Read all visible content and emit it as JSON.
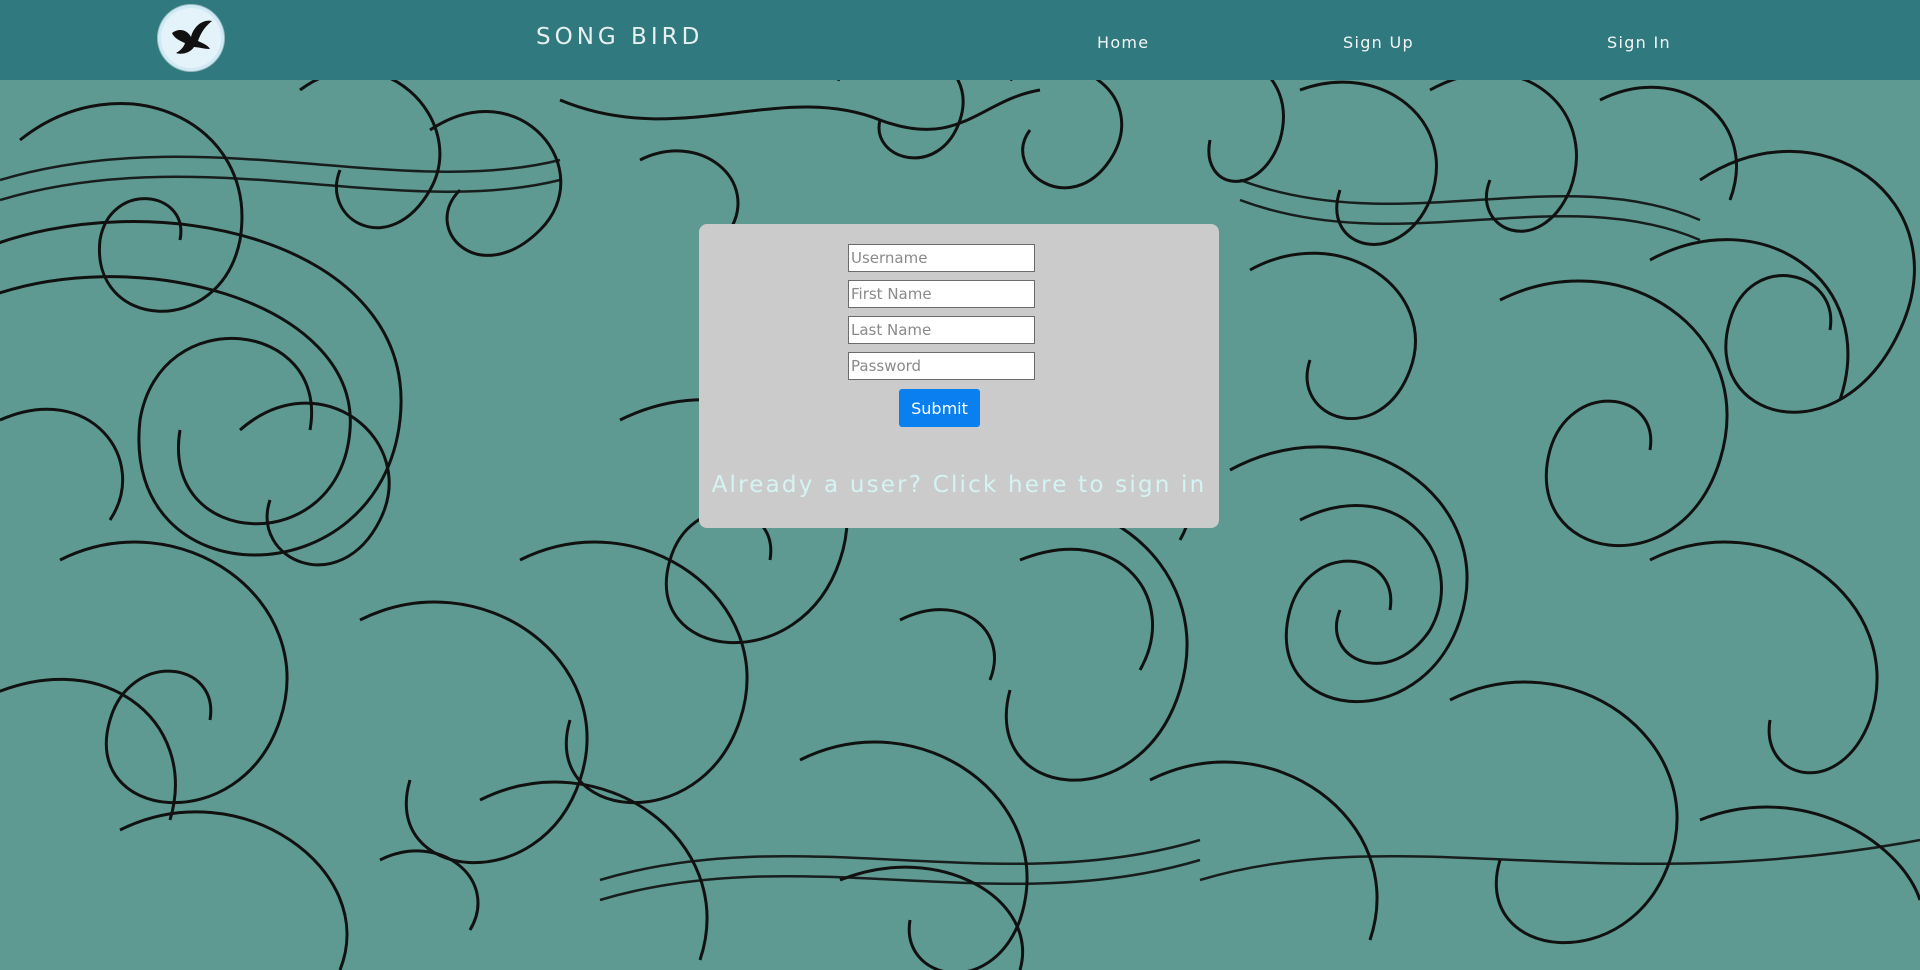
{
  "header": {
    "logo_icon": "bird-logo-icon",
    "brand": "SONG BIRD",
    "nav": {
      "home": "Home",
      "sign_up": "Sign Up",
      "sign_in": "Sign In"
    }
  },
  "form": {
    "username_placeholder": "Username",
    "first_name_placeholder": "First Name",
    "last_name_placeholder": "Last Name",
    "password_placeholder": "Password",
    "submit_label": "Submit",
    "signin_link": "Already a user? Click here to sign in"
  },
  "colors": {
    "navbar": "#30797e",
    "background_teal": "#5e9a92",
    "card": "#cbcbcb",
    "submit": "#0a7ff0",
    "signin_link": "#d6f3f3"
  }
}
